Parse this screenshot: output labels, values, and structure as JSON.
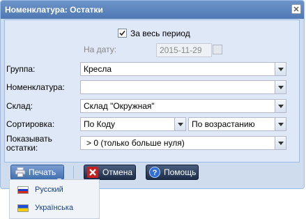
{
  "window": {
    "title": "Номенклатура: Остатки"
  },
  "form": {
    "whole_period": {
      "label": "За весь период",
      "checked": true
    },
    "on_date": {
      "label": "На дату:",
      "value": "2015-11-29"
    },
    "group": {
      "label": "Группа:",
      "value": "Кресла"
    },
    "nomenclature": {
      "label": "Номенклатура:",
      "value": ""
    },
    "warehouse": {
      "label": "Склад:",
      "value": "Склад \"Окружная\""
    },
    "sorting": {
      "label": "Сортировка:",
      "field": "По Коду",
      "order": "По возрастанию"
    },
    "show_remains": {
      "label_line1": "Показывать",
      "label_line2": "остатки:",
      "value": "> 0 (только больше нуля)"
    }
  },
  "toolbar": {
    "print_label": "Печать",
    "cancel_label": "Отмена",
    "help_label": "Помощь"
  },
  "print_menu": {
    "items": [
      {
        "label": "Русский"
      },
      {
        "label": "Українська"
      }
    ]
  },
  "colors": {
    "header": "#4f78b4",
    "body": "#dfe8f6",
    "menu_text": "#15428b"
  }
}
